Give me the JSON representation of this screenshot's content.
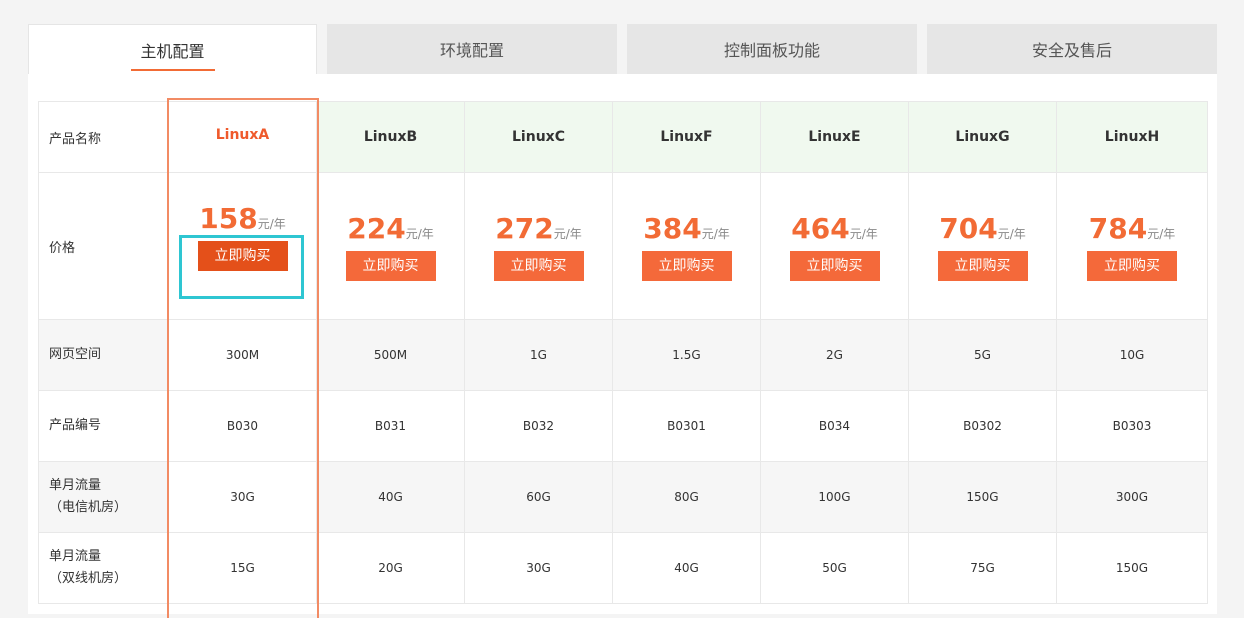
{
  "tabs": [
    {
      "label": "主机配置",
      "active": true
    },
    {
      "label": "环境配置",
      "active": false
    },
    {
      "label": "控制面板功能",
      "active": false
    },
    {
      "label": "安全及售后",
      "active": false
    }
  ],
  "row_labels": {
    "name": "产品名称",
    "price": "价格",
    "space": "网页空间",
    "code": "产品编号",
    "traffic_telecom_1": "单月流量",
    "traffic_telecom_2": "（电信机房）",
    "traffic_dual_1": "单月流量",
    "traffic_dual_2": "（双线机房）"
  },
  "buy_label": "立即购买",
  "price_unit": "元/年",
  "products": [
    {
      "name": "LinuxA",
      "price": "158",
      "space": "300M",
      "code": "B030",
      "traffic_telecom": "30G",
      "traffic_dual": "15G",
      "featured": true
    },
    {
      "name": "LinuxB",
      "price": "224",
      "space": "500M",
      "code": "B031",
      "traffic_telecom": "40G",
      "traffic_dual": "20G"
    },
    {
      "name": "LinuxC",
      "price": "272",
      "space": "1G",
      "code": "B032",
      "traffic_telecom": "60G",
      "traffic_dual": "30G"
    },
    {
      "name": "LinuxF",
      "price": "384",
      "space": "1.5G",
      "code": "B0301",
      "traffic_telecom": "80G",
      "traffic_dual": "40G"
    },
    {
      "name": "LinuxE",
      "price": "464",
      "space": "2G",
      "code": "B034",
      "traffic_telecom": "100G",
      "traffic_dual": "50G"
    },
    {
      "name": "LinuxG",
      "price": "704",
      "space": "5G",
      "code": "B0302",
      "traffic_telecom": "150G",
      "traffic_dual": "75G"
    },
    {
      "name": "LinuxH",
      "price": "784",
      "space": "10G",
      "code": "B0303",
      "traffic_telecom": "300G",
      "traffic_dual": "150G"
    }
  ],
  "colors": {
    "accent": "#f26b35",
    "highlight_border": "#f28b64",
    "focus_frame": "#2ec6d2",
    "header_bg": "#f0f9ef"
  }
}
